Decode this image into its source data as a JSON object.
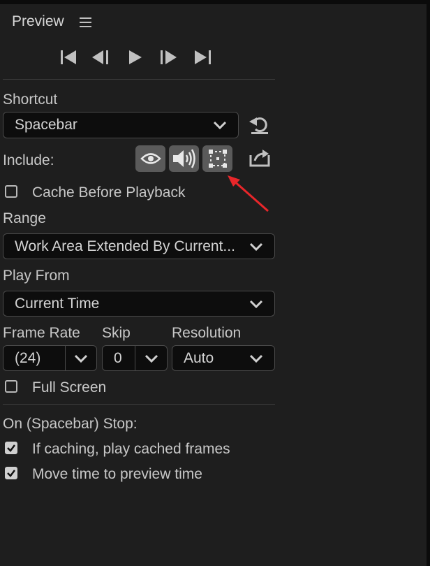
{
  "panel": {
    "title": "Preview",
    "menu_icon": "hamburger-menu-icon"
  },
  "transport": {
    "buttons": [
      {
        "name": "first-frame-icon"
      },
      {
        "name": "previous-frame-icon"
      },
      {
        "name": "play-icon"
      },
      {
        "name": "next-frame-icon"
      },
      {
        "name": "last-frame-icon"
      }
    ]
  },
  "shortcut": {
    "label": "Shortcut",
    "value": "Spacebar",
    "reset_icon": "reset-icon"
  },
  "include": {
    "label": "Include:",
    "toggles": [
      {
        "name": "video-eye-icon",
        "active": true
      },
      {
        "name": "audio-speaker-icon",
        "active": true
      },
      {
        "name": "overlays-layer-controls-icon",
        "active": true
      }
    ],
    "export_icon": "export-share-icon"
  },
  "cache_before_playback": {
    "label": "Cache Before Playback",
    "checked": false
  },
  "range": {
    "label": "Range",
    "value": "Work Area Extended By Current..."
  },
  "play_from": {
    "label": "Play From",
    "value": "Current Time"
  },
  "frame_rate": {
    "label": "Frame Rate",
    "value": "(24)"
  },
  "skip": {
    "label": "Skip",
    "value": "0"
  },
  "resolution": {
    "label": "Resolution",
    "value": "Auto"
  },
  "full_screen": {
    "label": "Full Screen",
    "checked": false
  },
  "on_stop": {
    "label": "On (Spacebar) Stop:",
    "options": [
      {
        "label": "If caching, play cached frames",
        "checked": true
      },
      {
        "label": "Move time to preview time",
        "checked": true
      }
    ]
  },
  "annotation": {
    "arrow_color": "#e8262a"
  },
  "colors": {
    "background": "#1e1e1e",
    "dropdown_bg": "#0d0d0d",
    "toggle_bg": "#5a5a5a"
  }
}
